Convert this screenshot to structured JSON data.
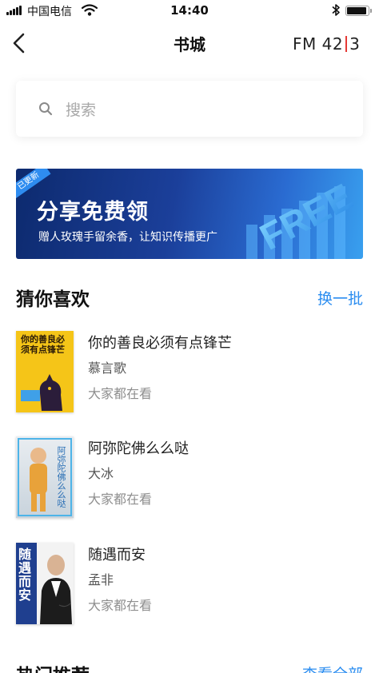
{
  "status_bar": {
    "carrier": "中国电信",
    "time": "14:40",
    "battery_level": 0.85
  },
  "nav": {
    "title": "书城",
    "logo_left": "FM 42",
    "logo_right": "3"
  },
  "search": {
    "placeholder": "搜索"
  },
  "banner": {
    "badge": "已更新",
    "title": "分享免费领",
    "subtitle": "赠人玫瑰手留余香，让知识传播更广",
    "art_text": "FREE"
  },
  "section_guess": {
    "title": "猜你喜欢",
    "action": "换一批"
  },
  "books": [
    {
      "title": "你的善良必须有点锋芒",
      "author": "慕言歌",
      "tag": "大家都在看",
      "cover_text": "你的善良必须有点锋芒"
    },
    {
      "title": "阿弥陀佛么么哒",
      "author": "大冰",
      "tag": "大家都在看",
      "cover_text": "阿弥陀佛么么哒"
    },
    {
      "title": "随遇而安",
      "author": "孟非",
      "tag": "大家都在看",
      "cover_text": "随遇而安"
    }
  ],
  "section_hot": {
    "title": "热门推荐",
    "action": "查看全部"
  },
  "colors": {
    "accent": "#2b8df0",
    "fm_bar": "#e53935",
    "banner_dark": "#0d2a6e",
    "banner_light": "#39a0ef"
  }
}
